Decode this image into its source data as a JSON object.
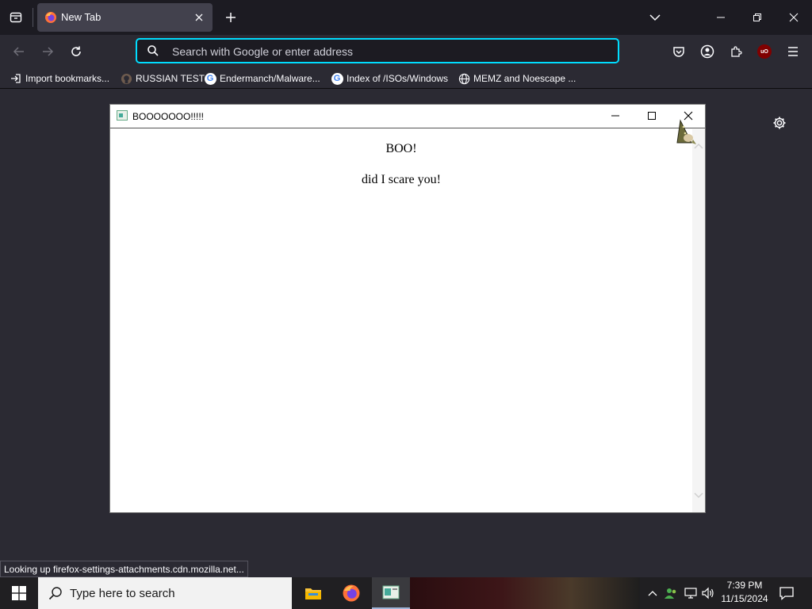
{
  "browser": {
    "tab_title": "New Tab",
    "url_placeholder": "Search with Google or enter address",
    "bookmarks": [
      {
        "label": "Import bookmarks...",
        "icon": "import-icon"
      },
      {
        "label": "RUSSIAN TEST",
        "icon": "github-icon"
      },
      {
        "label": "Endermanch/Malware...",
        "icon": "google-icon"
      },
      {
        "label": "Index of /ISOs/Windows",
        "icon": "google-icon"
      },
      {
        "label": "MEMZ and Noescape ...",
        "icon": "globe-icon"
      }
    ],
    "accent_color": "#00ddff"
  },
  "popup": {
    "title": "BOOOOOOO!!!!!",
    "heading": "BOO!",
    "message": "did I scare you!"
  },
  "status_bar": {
    "text": "Looking up firefox-settings-attachments.cdn.mozilla.net..."
  },
  "taskbar": {
    "search_placeholder": "Type here to search",
    "time": "7:39 PM",
    "date": "11/15/2024"
  }
}
